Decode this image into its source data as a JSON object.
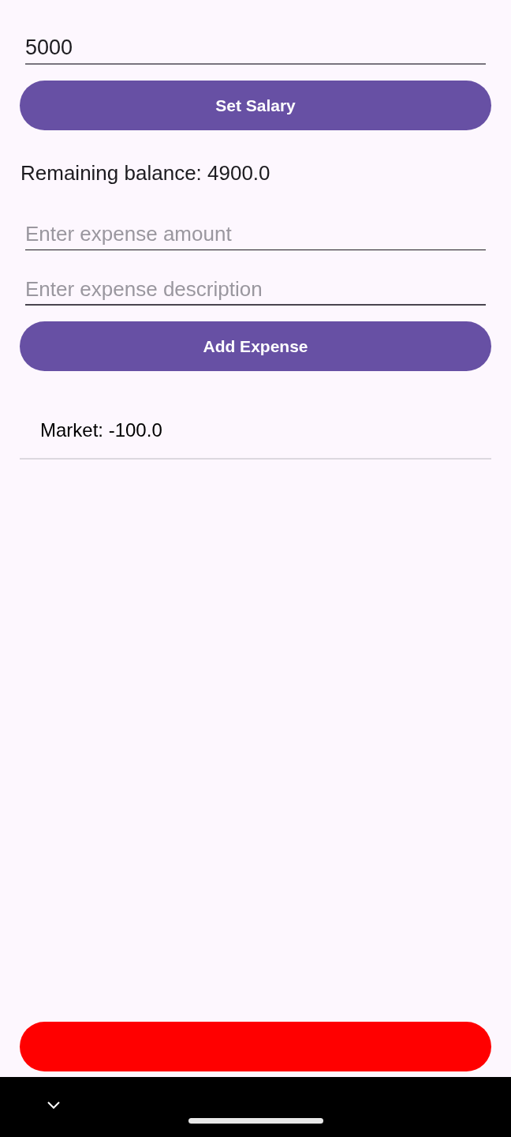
{
  "salary_field": {
    "value": "5000"
  },
  "set_salary_button": {
    "label": "Set Salary"
  },
  "balance": "Remaining balance: 4900.0",
  "expense_amount_field": {
    "placeholder": "Enter expense amount",
    "focused": false
  },
  "expense_description_field": {
    "placeholder": "Enter expense description",
    "focused": true
  },
  "add_expense_button": {
    "label": "Add Expense"
  },
  "expenses": [
    {
      "text": "Market: -100.0"
    }
  ]
}
